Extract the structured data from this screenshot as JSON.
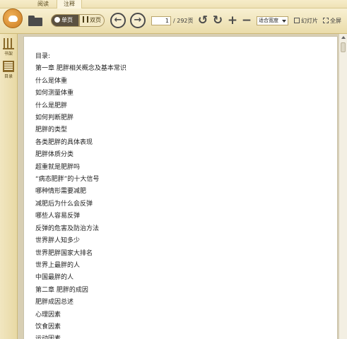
{
  "tabs": [
    {
      "label": "阅读"
    },
    {
      "label": "注释"
    }
  ],
  "toolbar": {
    "single_page_label": "单页",
    "double_page_label": "双页",
    "current_page": "1",
    "total_pages": "/ 292页",
    "zoom_value": "适合宽度",
    "slideshow_label": "幻灯片",
    "fullscreen_label": "全屏"
  },
  "sidebar": {
    "items": [
      {
        "label": "书架",
        "icon": "bookshelf-icon"
      },
      {
        "label": "目录",
        "icon": "toc-icon"
      }
    ]
  },
  "page": {
    "title": "目录:",
    "lines": [
      "第一章  肥胖相关概念及基本常识",
      "什么是体重",
      "如何测量体重",
      "什么是肥胖",
      "如何判断肥胖",
      "肥胖的类型",
      "各类肥胖的具体表现",
      "肥胖体质分类",
      "超重就是肥胖吗",
      "“病态肥胖”的十大信号",
      "哪种情形需要减肥",
      "减肥后为什么会反弹",
      "哪些人容易反弹",
      "反弹的危害及防治方法",
      "世界胖人知多少",
      "世界肥胖国家大排名",
      "世界上最胖的人",
      "中国最胖的人",
      "第二章  肥胖的成因",
      "肥胖成因总述",
      "心理因素",
      "饮食因素",
      "运动因素"
    ]
  },
  "colors": {
    "toolbar_bg": "#eadcaa",
    "accent": "#5b5140"
  }
}
